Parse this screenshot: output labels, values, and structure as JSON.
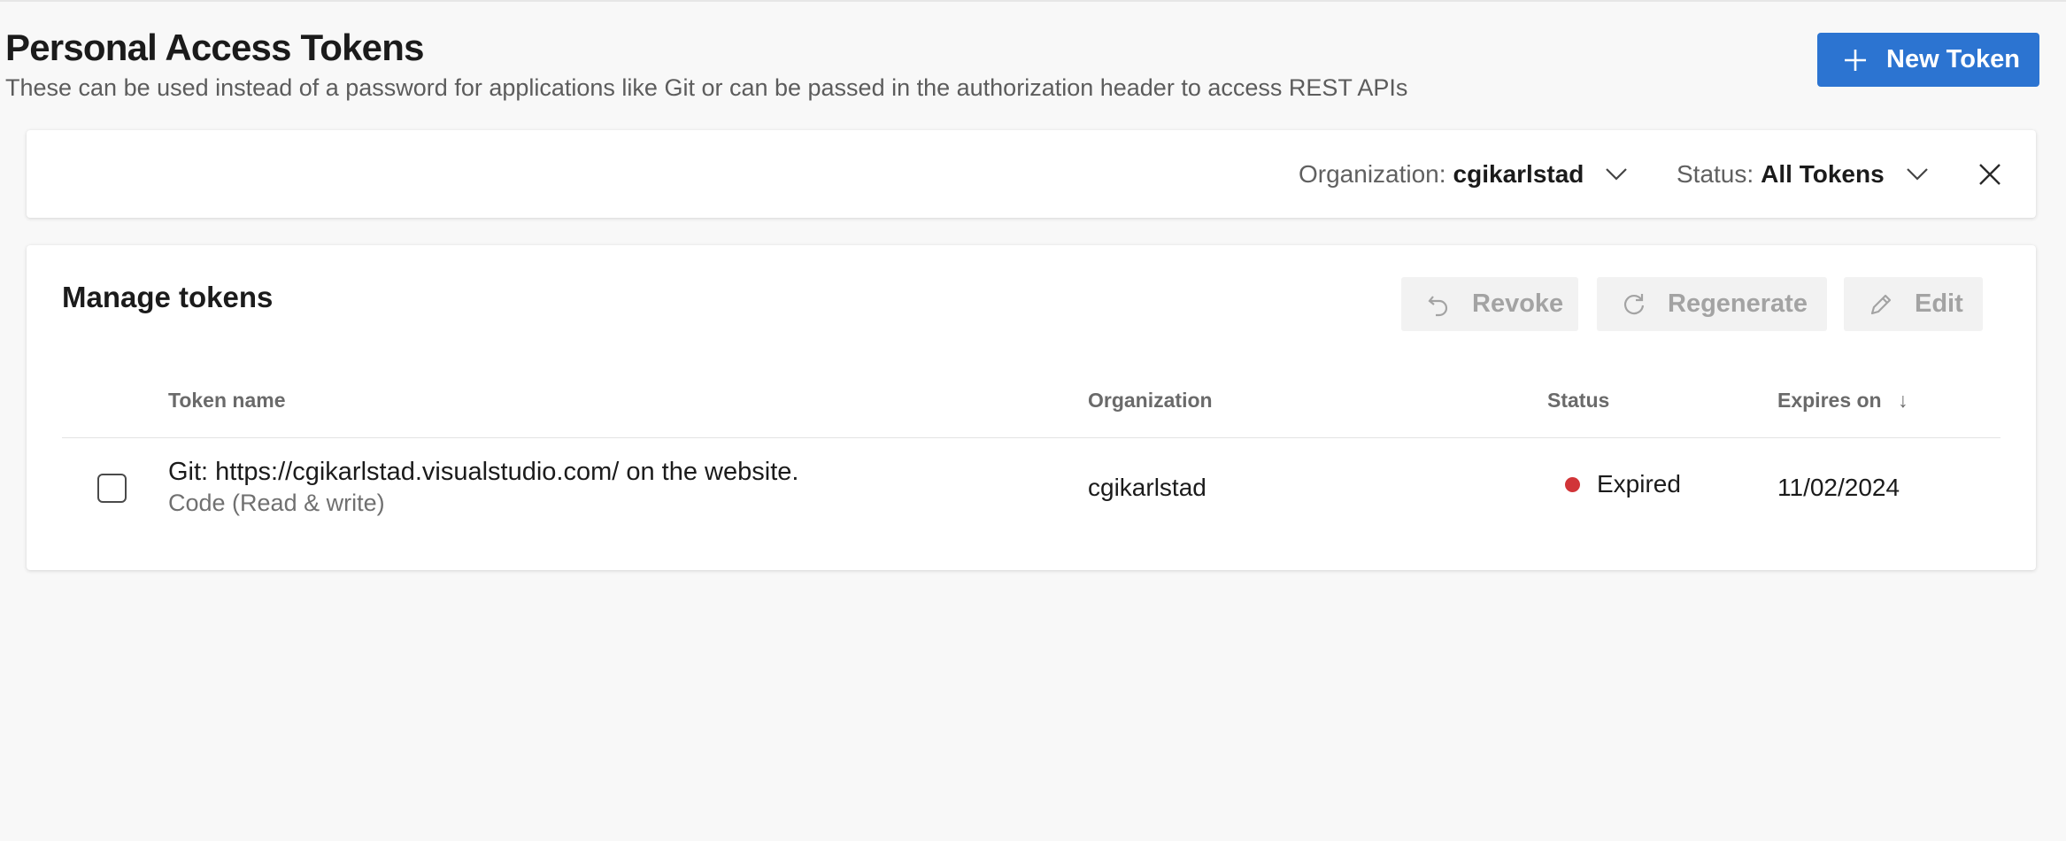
{
  "header": {
    "title": "Personal Access Tokens",
    "subtitle": "These can be used instead of a password for applications like Git or can be passed in the authorization header to access REST APIs",
    "new_token_label": "New Token",
    "new_token_icon": "plus-icon",
    "accent_color": "#2c74d1"
  },
  "filters": {
    "organization": {
      "label": "Organization:",
      "value": "cgikarlstad",
      "icon": "chevron-down-icon"
    },
    "status": {
      "label": "Status:",
      "value": "All Tokens",
      "icon": "chevron-down-icon"
    },
    "close_icon": "close-icon"
  },
  "manage": {
    "title": "Manage tokens",
    "actions": {
      "revoke": {
        "label": "Revoke",
        "icon": "undo-icon",
        "enabled": false
      },
      "regenerate": {
        "label": "Regenerate",
        "icon": "refresh-icon",
        "enabled": false
      },
      "edit": {
        "label": "Edit",
        "icon": "pencil-icon",
        "enabled": false
      }
    }
  },
  "table": {
    "columns": {
      "name": "Token name",
      "organization": "Organization",
      "status": "Status",
      "expires": "Expires on",
      "expires_sort_icon": "↓"
    },
    "rows": [
      {
        "name": "Git: https://cgikarlstad.visualstudio.com/ on the website.",
        "scope": "Code (Read & write)",
        "organization": "cgikarlstad",
        "status": "Expired",
        "status_color": "#d13438",
        "expires": "11/02/2024",
        "checked": false
      }
    ]
  }
}
